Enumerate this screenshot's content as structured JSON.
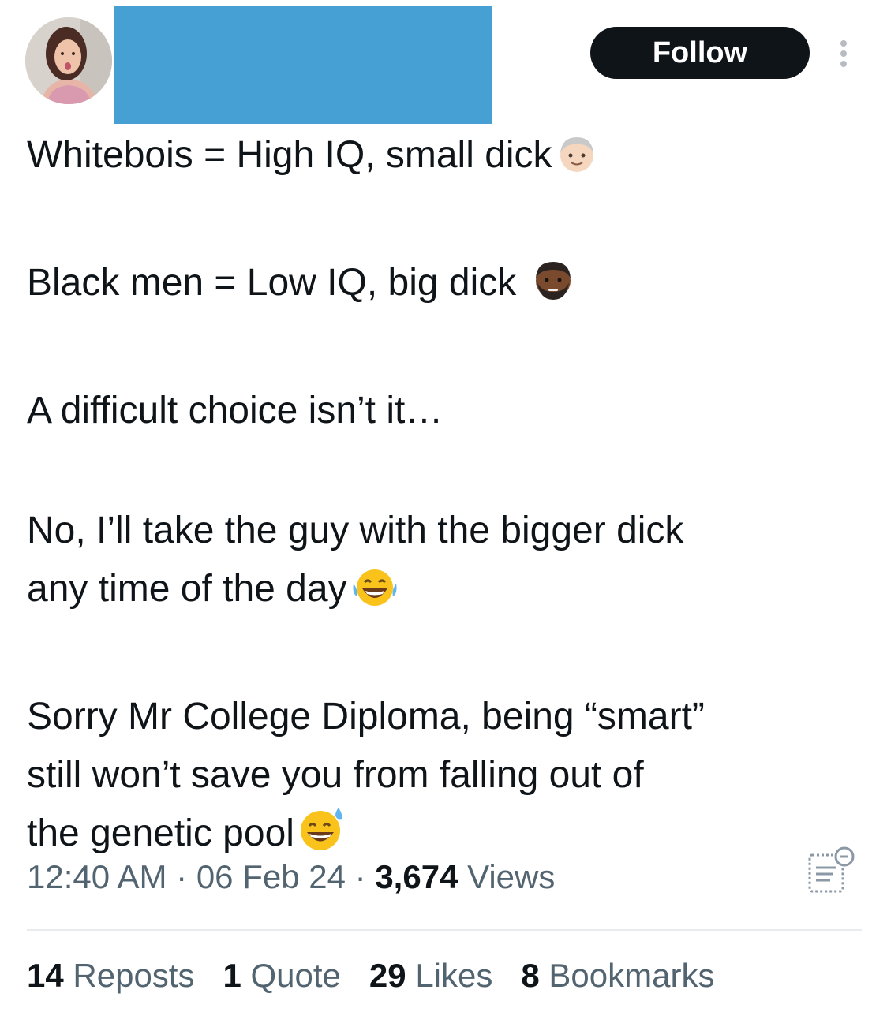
{
  "header": {
    "avatar_icon": "avatar-photo",
    "redaction_color": "#47a0d4",
    "follow_label": "Follow",
    "more_icon": "vertical-dots-icon"
  },
  "tweet": {
    "paragraphs": [
      {
        "text": "Whitebois = High IQ, small dick",
        "emoji": "older-man-emoji"
      },
      {
        "text": "Black men = Low IQ, big dick ",
        "emoji": "bearded-man-dark-skin-emoji"
      },
      {
        "text": "A difficult choice isn’t it…",
        "emoji": ""
      },
      {
        "line1": "No, I’ll take the guy with the bigger dick",
        "line2": "any time of the day",
        "emoji": "tears-of-joy-emoji"
      },
      {
        "line1": "Sorry Mr College Diploma, being “smart”",
        "line2": "still won’t save you from falling out of",
        "line3": "the genetic pool",
        "emoji": "grinning-sweat-emoji"
      }
    ]
  },
  "meta": {
    "time": "12:40 AM",
    "separator": "·",
    "date": "06 Feb 24",
    "views_count": "3,674",
    "views_label": "Views",
    "analytics_icon": "analytics-icon"
  },
  "stats": {
    "reposts_count": "14",
    "reposts_label": "Reposts",
    "quotes_count": "1",
    "quotes_label": "Quote",
    "likes_count": "29",
    "likes_label": "Likes",
    "bookmarks_count": "8",
    "bookmarks_label": "Bookmarks"
  },
  "colors": {
    "text_primary": "#0f1419",
    "text_secondary": "#536471",
    "divider": "#e6ecf0",
    "follow_bg": "#0f1419"
  }
}
